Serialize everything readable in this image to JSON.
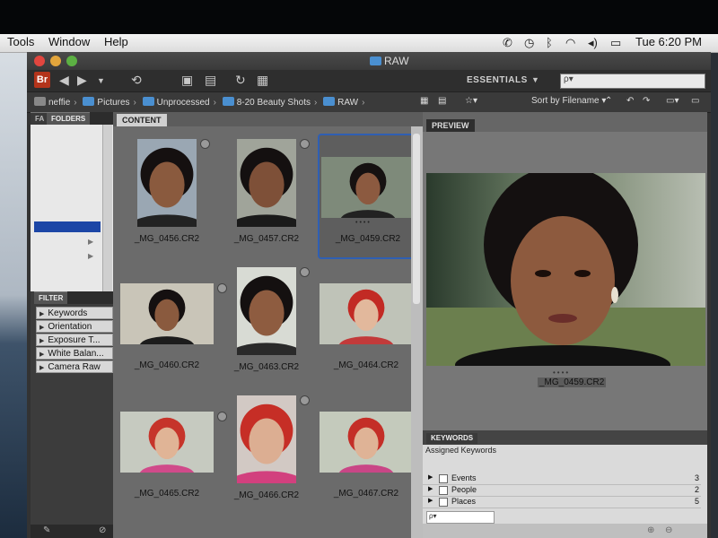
{
  "menubar": {
    "items": [
      "Tools",
      "Window",
      "Help"
    ],
    "clock": "Tue 6:20 PM"
  },
  "window": {
    "title": "RAW"
  },
  "toolbar": {
    "workspace": "ESSENTIALS",
    "search_placeholder": "ρ▾"
  },
  "path": {
    "crumbs": [
      "neffie",
      "Pictures",
      "Unprocessed",
      "8-20 Beauty Shots",
      "RAW"
    ],
    "sort_label": "Sort by Filename"
  },
  "panels": {
    "folders_tab_short": "FA",
    "folders_tab": "FOLDERS",
    "filter_tab": "FILTER",
    "content_tab": "CONTENT",
    "preview_tab": "PREVIEW",
    "keywords_tab": "KEYWORDS"
  },
  "filter": {
    "items": [
      "Keywords",
      "Orientation",
      "Exposure T...",
      "White Balan...",
      "Camera Raw"
    ]
  },
  "content": {
    "files": [
      {
        "name": "_MG_0456.CR2",
        "orientation": "portrait",
        "selected": false
      },
      {
        "name": "_MG_0457.CR2",
        "orientation": "portrait",
        "selected": false
      },
      {
        "name": "_MG_0459.CR2",
        "orientation": "landscape",
        "selected": true
      },
      {
        "name": "_MG_0460.CR2",
        "orientation": "landscape",
        "selected": false
      },
      {
        "name": "_MG_0463.CR2",
        "orientation": "portrait",
        "selected": false
      },
      {
        "name": "_MG_0464.CR2",
        "orientation": "landscape",
        "selected": false
      },
      {
        "name": "_MG_0465.CR2",
        "orientation": "landscape",
        "selected": false
      },
      {
        "name": "_MG_0466.CR2",
        "orientation": "portrait",
        "selected": false
      },
      {
        "name": "_MG_0467.CR2",
        "orientation": "landscape",
        "selected": false
      }
    ]
  },
  "preview": {
    "filename": "_MG_0459.CR2"
  },
  "keywords": {
    "assigned_label": "Assigned Keywords",
    "rows": [
      {
        "label": "Events",
        "count": "3"
      },
      {
        "label": "People",
        "count": "2"
      },
      {
        "label": "Places",
        "count": "5"
      }
    ]
  },
  "colors": {
    "selection": "#2f5fb3",
    "bridge_logo": "#b3341b",
    "folder_selected": "#1c46a6"
  }
}
